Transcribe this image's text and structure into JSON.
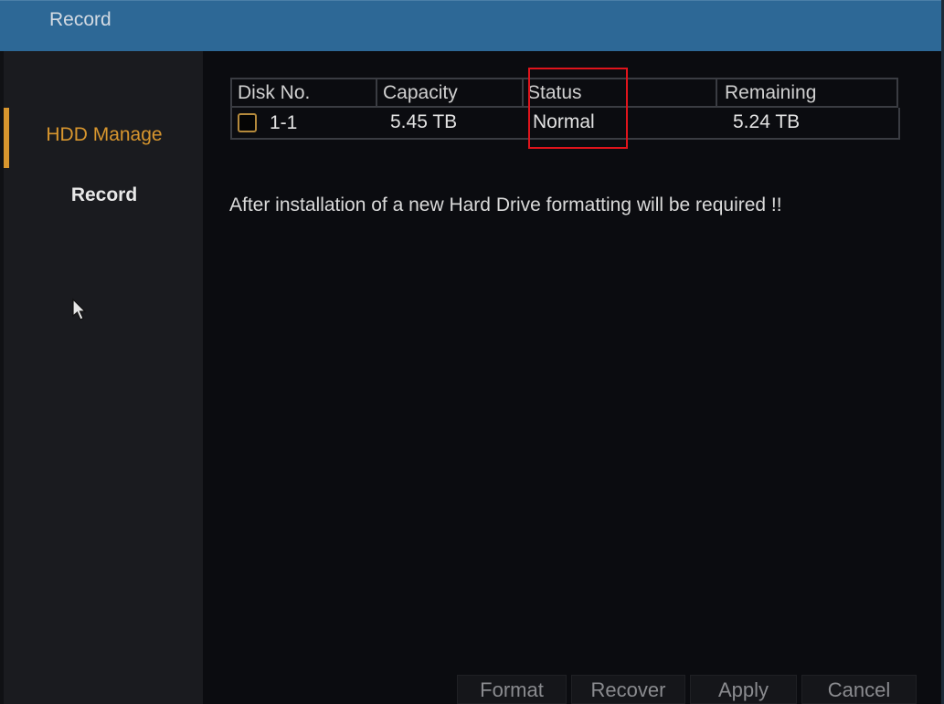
{
  "window": {
    "title": "Record"
  },
  "sidebar": {
    "items": [
      {
        "label": "HDD Manage",
        "active": true
      },
      {
        "label": "Record",
        "active": false
      }
    ]
  },
  "disk_table": {
    "columns": [
      "Disk No.",
      "Capacity",
      "Status",
      "Remaining"
    ],
    "rows": [
      {
        "selected": false,
        "disk_no": "1-1",
        "capacity": "5.45 TB",
        "status": "Normal",
        "remaining": "5.24 TB"
      }
    ]
  },
  "notice": "After installation of a new Hard Drive formatting will be required !!",
  "buttons": {
    "format": "Format",
    "recover": "Recover",
    "apply": "Apply",
    "cancel": "Cancel"
  },
  "colors": {
    "titlebar": "#2d6896",
    "accent": "#d8962e",
    "highlight": "#e0141c"
  }
}
